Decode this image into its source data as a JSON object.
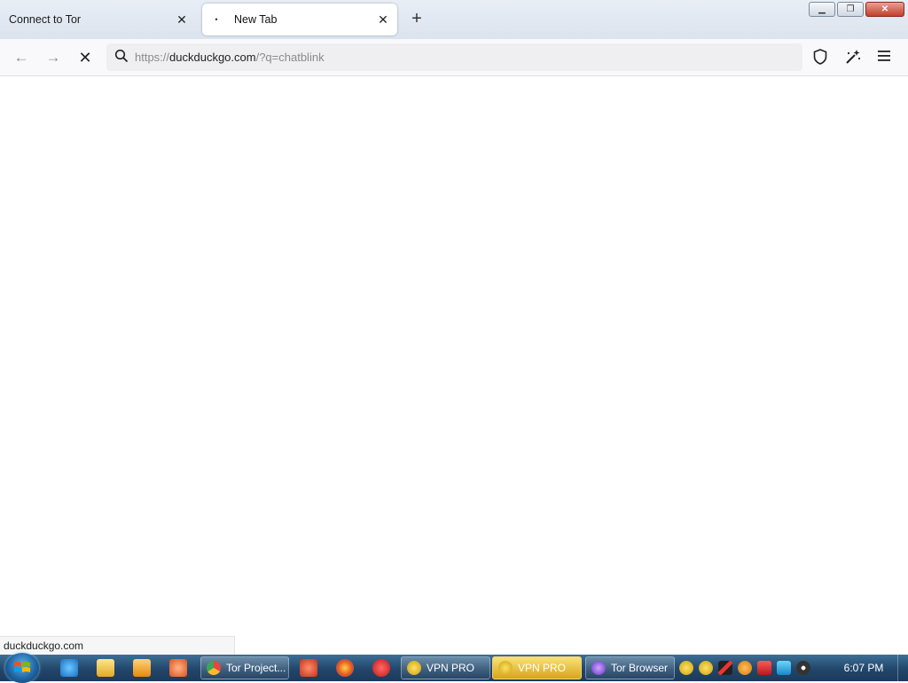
{
  "tabs": [
    {
      "label": "Connect to Tor",
      "active": false
    },
    {
      "label": "New Tab",
      "active": true
    }
  ],
  "nav": {
    "url_scheme": "https://",
    "url_host": "duckduckgo.com",
    "url_path": "/?q=chatblink"
  },
  "status_url": "duckduckgo.com",
  "taskbar": {
    "tasks": [
      {
        "label": "Tor Project...",
        "icon": "chrome-icon"
      },
      {
        "label": "VPN PRO",
        "icon": "vpn-icon"
      },
      {
        "label": "VPN PRO",
        "icon": "vpn-icon"
      },
      {
        "label": "Tor Browser",
        "icon": "tor-icon"
      }
    ],
    "clock": "6:07 PM"
  },
  "colors": {
    "taskbar": "#22466a",
    "active_task": "#d9a419",
    "url_bar": "#efeff2"
  }
}
